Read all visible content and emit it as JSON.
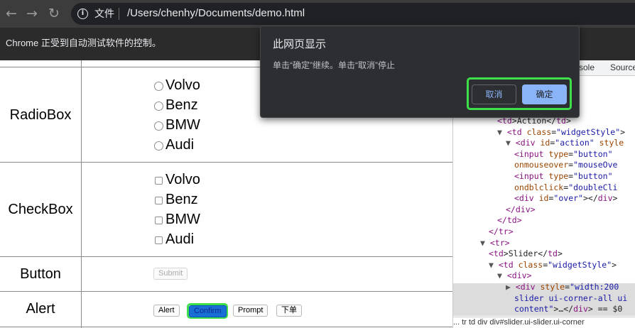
{
  "browser": {
    "back_glyph": "←",
    "forward_glyph": "→",
    "reload_glyph": "↻",
    "address": {
      "info_glyph": "i",
      "scheme_label": "文件",
      "url": "/Users/chenhy/Documents/demo.html"
    }
  },
  "infobar": {
    "text": "Chrome 正受到自动测试软件的控制。"
  },
  "page": {
    "rows": {
      "radio": {
        "label": "RadioBox",
        "options": [
          "Volvo",
          "Benz",
          "BMW",
          "Audi"
        ]
      },
      "checkbox": {
        "label": "CheckBox",
        "options": [
          "Volvo",
          "Benz",
          "BMW",
          "Audi"
        ]
      },
      "button": {
        "label": "Button",
        "submit_label": "Submit"
      },
      "alert": {
        "label": "Alert",
        "buttons": [
          "Alert",
          "Confirm",
          "Prompt",
          "下单"
        ]
      }
    }
  },
  "devtools": {
    "tabs": [
      "sole",
      "Source"
    ],
    "lines": [
      {
        "pre": "    ",
        "parts": [
          [
            "t",
            "<td"
          ],
          [
            "x",
            ">Action</"
          ],
          [
            "t",
            "td"
          ],
          [
            "x",
            ">"
          ]
        ]
      },
      {
        "pre": "  ▼ ",
        "parts": [
          [
            "t",
            "<td "
          ],
          [
            "a",
            "class"
          ],
          [
            "x",
            "="
          ],
          [
            "v",
            "\"widgetStyle\""
          ],
          [
            "x",
            ">"
          ]
        ]
      },
      {
        "pre": "    ▼ ",
        "parts": [
          [
            "t",
            "<div "
          ],
          [
            "a",
            "id"
          ],
          [
            "x",
            "="
          ],
          [
            "v",
            "\"action\""
          ],
          [
            "x",
            " "
          ],
          [
            "a",
            "style"
          ]
        ]
      },
      {
        "pre": "        ",
        "parts": [
          [
            "t",
            "<input "
          ],
          [
            "a",
            "type"
          ],
          [
            "x",
            "="
          ],
          [
            "v",
            "\"button\""
          ]
        ]
      },
      {
        "pre": "        ",
        "parts": [
          [
            "a",
            "onmouseover"
          ],
          [
            "x",
            "="
          ],
          [
            "v",
            "\"mouseOve"
          ]
        ]
      },
      {
        "pre": "        ",
        "parts": [
          [
            "t",
            "<input "
          ],
          [
            "a",
            "type"
          ],
          [
            "x",
            "="
          ],
          [
            "v",
            "\"button\""
          ]
        ]
      },
      {
        "pre": "        ",
        "parts": [
          [
            "a",
            "ondblclick"
          ],
          [
            "x",
            "="
          ],
          [
            "v",
            "\"doubleCli"
          ]
        ]
      },
      {
        "pre": "        ",
        "parts": [
          [
            "t",
            "<div "
          ],
          [
            "a",
            "id"
          ],
          [
            "x",
            "="
          ],
          [
            "v",
            "\"over\""
          ],
          [
            "x",
            "></"
          ],
          [
            "t",
            "div"
          ],
          [
            "x",
            ">"
          ]
        ]
      },
      {
        "pre": "      ",
        "parts": [
          [
            "t",
            "</div>"
          ]
        ]
      },
      {
        "pre": "    ",
        "parts": [
          [
            "t",
            "</td>"
          ]
        ]
      },
      {
        "pre": "  ",
        "parts": [
          [
            "t",
            "</tr>"
          ]
        ]
      },
      {
        "pre": "▼ ",
        "parts": [
          [
            "t",
            "<tr>"
          ]
        ]
      },
      {
        "pre": "    ",
        "parts": [
          [
            "t",
            "<td"
          ],
          [
            "x",
            ">Slider</"
          ],
          [
            "t",
            "td"
          ],
          [
            "x",
            ">"
          ]
        ]
      },
      {
        "pre": "  ▼ ",
        "parts": [
          [
            "t",
            "<td "
          ],
          [
            "a",
            "class"
          ],
          [
            "x",
            "="
          ],
          [
            "v",
            "\"widgetStyle\""
          ],
          [
            "x",
            ">"
          ]
        ]
      },
      {
        "pre": "    ▼ ",
        "parts": [
          [
            "t",
            "<div>"
          ]
        ]
      },
      {
        "pre": "      ▶ ",
        "parts": [
          [
            "t",
            "<div "
          ],
          [
            "a",
            "style"
          ],
          [
            "x",
            "="
          ],
          [
            "v",
            "\"width:200"
          ]
        ]
      },
      {
        "pre": "      ",
        "parts": [
          [
            "v",
            "slider ui-corner-all ui"
          ]
        ]
      },
      {
        "pre": "      ",
        "parts": [
          [
            "v",
            "content\""
          ],
          [
            "x",
            ">…</"
          ],
          [
            "t",
            "div"
          ],
          [
            "x",
            "> == $0"
          ]
        ]
      }
    ],
    "breadcrumbs": "...   tr   td   div   div#slider.ui-slider.ui-corner"
  },
  "dialog": {
    "title": "此网页显示",
    "message": "单击“确定”继续。单击“取消”停止",
    "cancel_label": "取消",
    "ok_label": "确定"
  },
  "colors": {
    "dialog_bg": "#2d2e31",
    "ok_button": "#8ab4f8",
    "highlight_ring": "#3ee04a",
    "toolbar_bg": "#3c3c3c"
  }
}
